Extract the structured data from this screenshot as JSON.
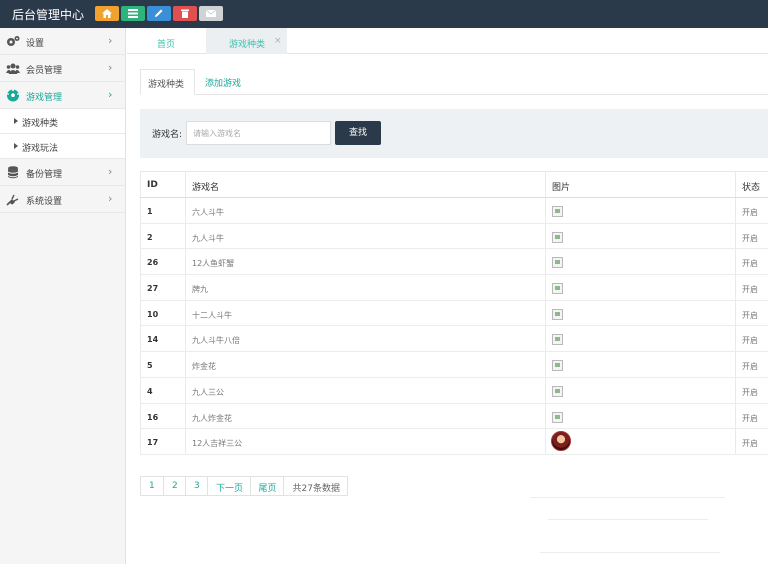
{
  "header": {
    "title": "后台管理中心",
    "quick_buttons": [
      {
        "icon": "home-icon",
        "color": "#f0a22e"
      },
      {
        "icon": "grid-icon",
        "color": "#2fb37c"
      },
      {
        "icon": "pencil-icon",
        "color": "#3b8fd6"
      },
      {
        "icon": "trash-icon",
        "color": "#e15050"
      },
      {
        "icon": "envelope-icon",
        "color": "#cfd3d6"
      }
    ]
  },
  "sidebar": {
    "items": [
      {
        "label": "设置",
        "icon": "gears-icon"
      },
      {
        "label": "会员管理",
        "icon": "users-icon"
      },
      {
        "label": "游戏管理",
        "icon": "soccer-ball-icon",
        "active": true
      },
      {
        "label": "备份管理",
        "icon": "database-icon"
      },
      {
        "label": "系统设置",
        "icon": "plug-icon"
      }
    ],
    "sub_items": [
      {
        "label": "游戏种类"
      },
      {
        "label": "游戏玩法"
      }
    ],
    "chevron": "›"
  },
  "tabstrip": {
    "home_label": "首页",
    "current_label": "游戏种类",
    "close_glyph": "×"
  },
  "content_tabs": {
    "active_label": "游戏种类",
    "add_label": "添加游戏"
  },
  "search": {
    "label": "游戏名:",
    "placeholder": "请输入游戏名",
    "button_label": "查找"
  },
  "table": {
    "headers": {
      "id": "ID",
      "name": "游戏名",
      "image": "图片",
      "status": "状态"
    },
    "rows": [
      {
        "id": "1",
        "name": "六人斗牛",
        "status": "开启",
        "image": "broken"
      },
      {
        "id": "2",
        "name": "九人斗牛",
        "status": "开启",
        "image": "broken"
      },
      {
        "id": "26",
        "name": "12人鱼虾蟹",
        "status": "开启",
        "image": "broken"
      },
      {
        "id": "27",
        "name": "牌九",
        "status": "开启",
        "image": "broken"
      },
      {
        "id": "10",
        "name": "十二人斗牛",
        "status": "开启",
        "image": "broken"
      },
      {
        "id": "14",
        "name": "九人斗牛八倍",
        "status": "开启",
        "image": "broken"
      },
      {
        "id": "5",
        "name": "炸金花",
        "status": "开启",
        "image": "broken"
      },
      {
        "id": "4",
        "name": "九人三公",
        "status": "开启",
        "image": "broken"
      },
      {
        "id": "16",
        "name": "九人炸金花",
        "status": "开启",
        "image": "broken"
      },
      {
        "id": "17",
        "name": "12人吉祥三公",
        "status": "开启",
        "image": "avatar"
      }
    ]
  },
  "pagination": {
    "pages": [
      "1",
      "2",
      "3"
    ],
    "next_label": "下一页",
    "last_label": "尾页",
    "total_label": "共27条数据"
  },
  "colors": {
    "header_bg": "#2b3a4a",
    "accent": "#1aa99a",
    "sidebar_bg": "#f5f5f5"
  }
}
